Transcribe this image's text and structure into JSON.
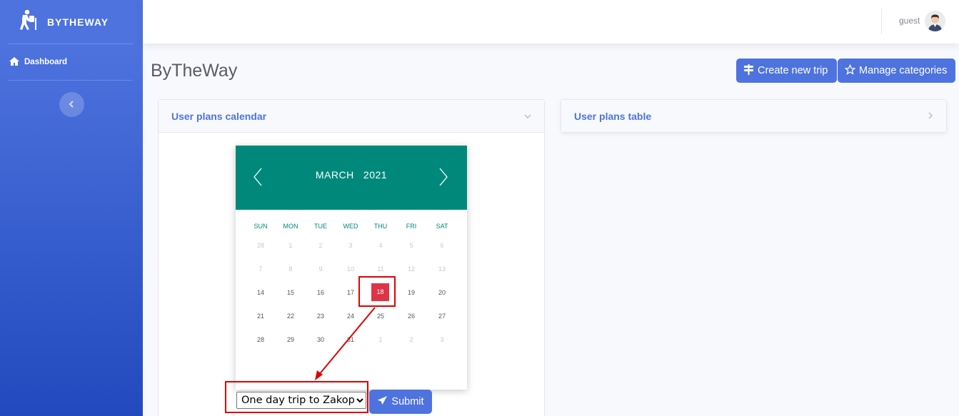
{
  "sidebar": {
    "brand": "BYTHEWAY",
    "items": [
      {
        "label": "Dashboard",
        "icon": "home-icon"
      }
    ],
    "toggle_icon": "chevron-left-icon"
  },
  "topbar": {
    "username": "guest"
  },
  "page": {
    "title": "ByTheWay"
  },
  "actions": {
    "create_label": "Create new trip",
    "manage_label": "Manage categories"
  },
  "cards": {
    "calendar_title": "User plans calendar",
    "table_title": "User plans table"
  },
  "calendar": {
    "month": "MARCH",
    "year": "2021",
    "weekdays": [
      "SUN",
      "MON",
      "TUE",
      "WED",
      "THU",
      "FRI",
      "SAT"
    ],
    "weeks": [
      [
        {
          "d": "28",
          "m": true
        },
        {
          "d": "1",
          "m": true
        },
        {
          "d": "2",
          "m": true
        },
        {
          "d": "3",
          "m": true
        },
        {
          "d": "4",
          "m": true
        },
        {
          "d": "5",
          "m": true
        },
        {
          "d": "6",
          "m": true
        }
      ],
      [
        {
          "d": "7",
          "m": true
        },
        {
          "d": "8",
          "m": true
        },
        {
          "d": "9",
          "m": true
        },
        {
          "d": "10",
          "m": true
        },
        {
          "d": "11",
          "m": true
        },
        {
          "d": "12",
          "m": true
        },
        {
          "d": "13",
          "m": true
        }
      ],
      [
        {
          "d": "14"
        },
        {
          "d": "15"
        },
        {
          "d": "16"
        },
        {
          "d": "17"
        },
        {
          "d": "18",
          "sel": true
        },
        {
          "d": "19"
        },
        {
          "d": "20"
        }
      ],
      [
        {
          "d": "21"
        },
        {
          "d": "22"
        },
        {
          "d": "23"
        },
        {
          "d": "24"
        },
        {
          "d": "25"
        },
        {
          "d": "26"
        },
        {
          "d": "27"
        }
      ],
      [
        {
          "d": "28"
        },
        {
          "d": "29"
        },
        {
          "d": "30"
        },
        {
          "d": "31"
        },
        {
          "d": "1",
          "m": true
        },
        {
          "d": "2",
          "m": true
        },
        {
          "d": "3",
          "m": true
        }
      ]
    ]
  },
  "form": {
    "trip_options": [
      "One day trip to Zakopane"
    ],
    "selected_trip": "One day trip to Zakopane",
    "submit_label": "Submit"
  },
  "colors": {
    "primary": "#4e73df",
    "calendar_header": "#00897b",
    "selected_day": "#dc3545",
    "annotation": "#e00000"
  }
}
